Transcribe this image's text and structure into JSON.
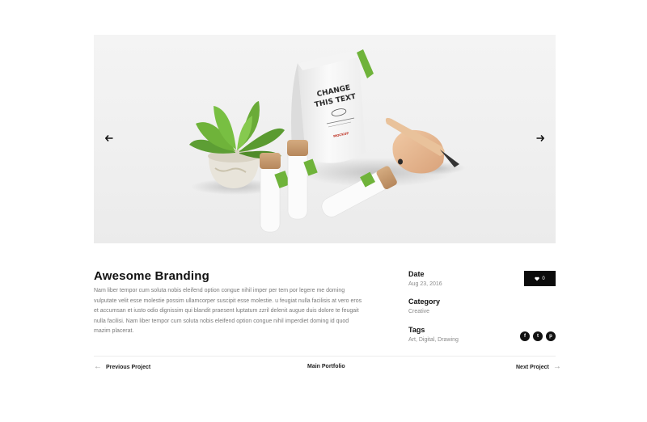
{
  "slider": {
    "prev_icon": "arrow-left-icon",
    "next_icon": "arrow-right-icon",
    "image": {
      "bag_text_line1": "CHANGE",
      "bag_text_line2": "THIS TEXT",
      "bag_tag": "MOCKUP"
    }
  },
  "project": {
    "title": "Awesome Branding",
    "description": "Nam liber tempor cum soluta nobis eleifend option congue nihil imper per tem por legere me doming vulputate velit esse molestie possim ullamcorper suscipit esse molestie. u feugiat nulla facilisis at vero eros et accumsan et iusto odio dignissim qui blandit praesent luptatum zzril delenit augue duis dolore te feugait nulla facilisi. Nam liber tempor cum soluta nobis eleifend option congue nihil imperdiet doming id quod mazim placerat."
  },
  "meta": {
    "date_label": "Date",
    "date_value": "Aug 23, 2016",
    "category_label": "Category",
    "category_value": "Creative",
    "tags_label": "Tags",
    "tags_value": "Art, Digital, Drawing"
  },
  "like": {
    "icon": "heart-icon",
    "count": "0"
  },
  "social": [
    {
      "name": "facebook-icon",
      "glyph": "f"
    },
    {
      "name": "twitter-icon",
      "glyph": "t"
    },
    {
      "name": "pinterest-icon",
      "glyph": "p"
    }
  ],
  "navigation": {
    "previous": "Previous Project",
    "main": "Main Portfolio",
    "next": "Next Project"
  },
  "colors": {
    "accent": "#111111",
    "muted_text": "#7a7a7a",
    "leaf_green": "#6fb33a"
  }
}
